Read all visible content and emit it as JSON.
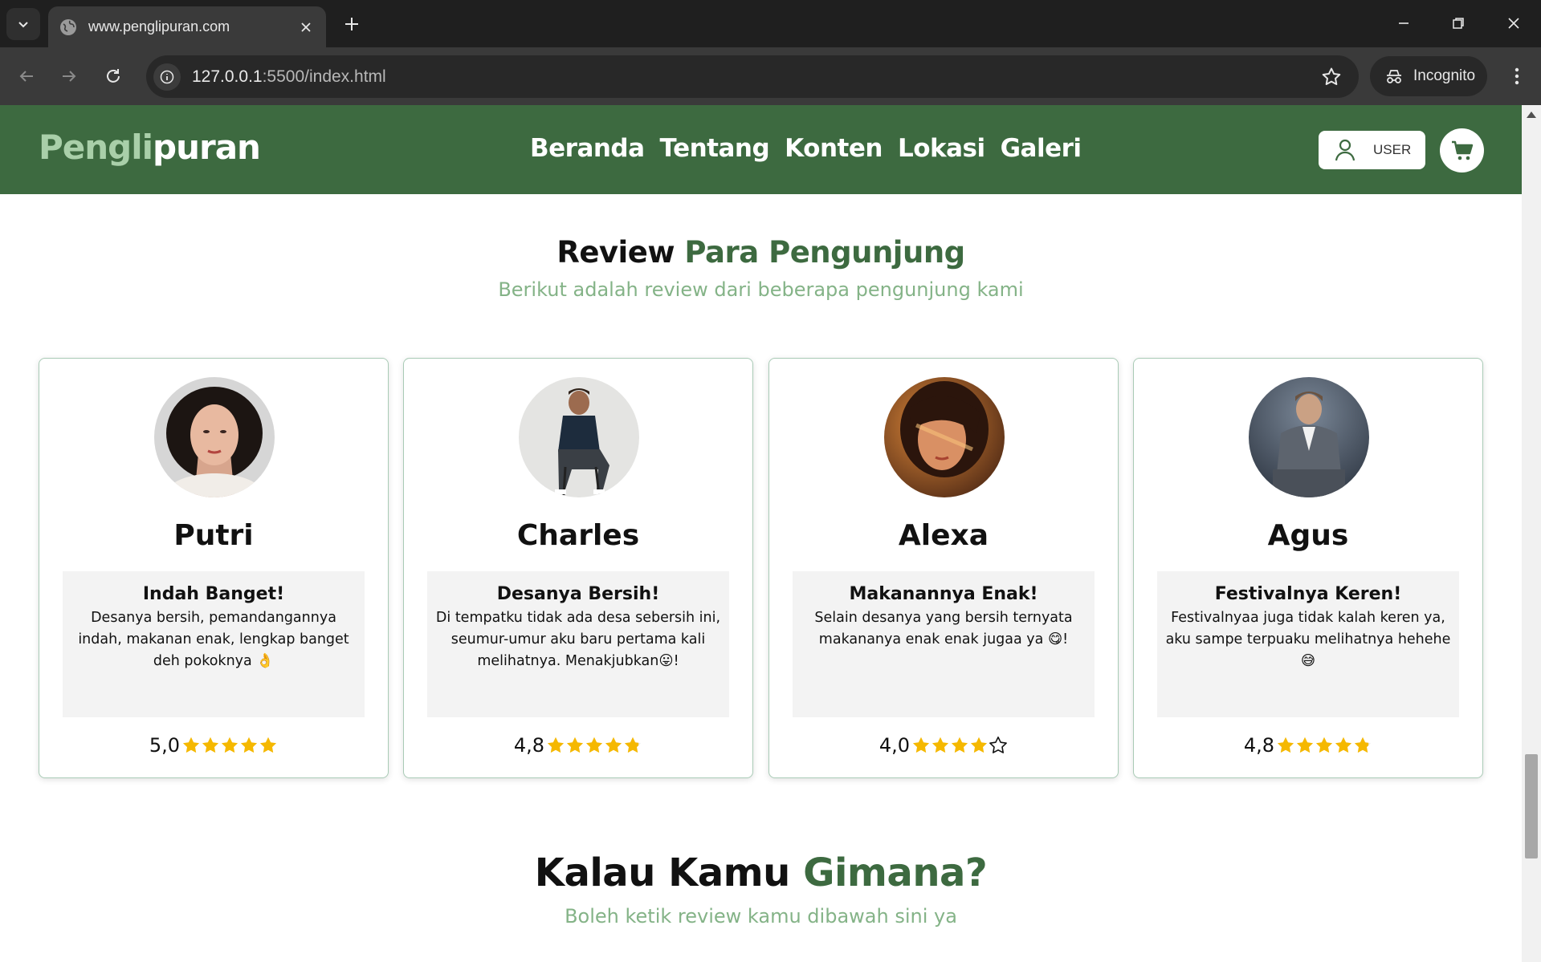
{
  "browser": {
    "tab_title": "www.penglipuran.com",
    "url_host": "127.0.0.1",
    "url_rest": ":5500/index.html",
    "incognito_label": "Incognito"
  },
  "navbar": {
    "logo_part1": "Pengli",
    "logo_part2": "puran",
    "menu": [
      "Beranda",
      "Tentang",
      "Konten",
      "Lokasi",
      "Galeri"
    ],
    "user_label": "USER"
  },
  "reviews_section": {
    "title_dark": "Review ",
    "title_green": "Para Pengunjung",
    "subtitle": "Berikut adalah review dari beberapa pengunjung kami"
  },
  "reviews": [
    {
      "name": "Putri",
      "title": "Indah Banget!",
      "text": "Desanya bersih, pemandangannya indah, makanan enak, lengkap banget deh pokoknya 👌",
      "score": "5,0",
      "stars": 5.0
    },
    {
      "name": "Charles",
      "title": "Desanya Bersih!",
      "text": "Di tempatku tidak ada desa sebersih ini, seumur-umur aku baru pertama kali melihatnya. Menakjubkan😛!",
      "score": "4,8",
      "stars": 4.8
    },
    {
      "name": "Alexa",
      "title": "Makanannya Enak!",
      "text": "Selain desanya yang bersih ternyata makananya enak enak jugaa ya 😋!",
      "score": "4,0",
      "stars": 4.0
    },
    {
      "name": "Agus",
      "title": "Festivalnya Keren!",
      "text": "Festivalnyaa juga tidak kalah keren ya, aku sampe terpuaku melihatnya hehehe😅",
      "score": "4,8",
      "stars": 4.8
    }
  ],
  "feedback_section": {
    "title_dark": "Kalau Kamu ",
    "title_green": "Gimana?",
    "subtitle": "Boleh ketik review kamu dibawah sini ya"
  },
  "colors": {
    "brand_green": "#3d6a40",
    "light_green": "#84b387",
    "star": "#f5b800"
  }
}
